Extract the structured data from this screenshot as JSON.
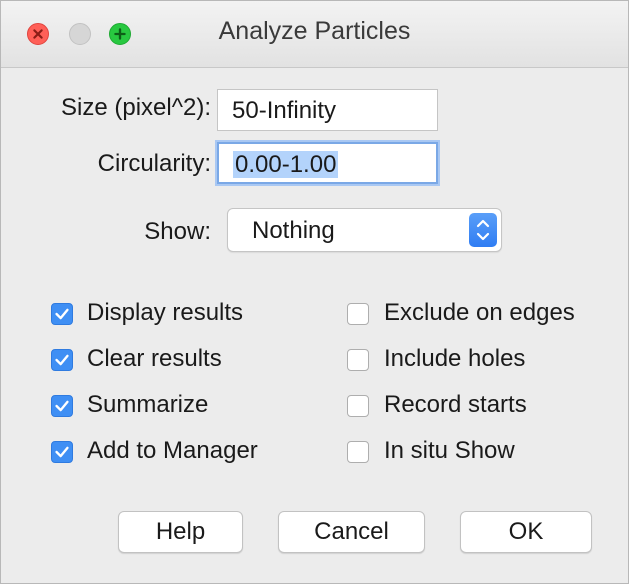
{
  "window": {
    "title": "Analyze Particles"
  },
  "fields": {
    "size": {
      "label": "Size (pixel^2):",
      "value": "50-Infinity"
    },
    "circularity": {
      "label": "Circularity:",
      "value": "0.00-1.00"
    }
  },
  "show": {
    "label": "Show:",
    "value": "Nothing"
  },
  "checkboxes": {
    "display_results": {
      "label": "Display results",
      "checked": true
    },
    "clear_results": {
      "label": "Clear results",
      "checked": true
    },
    "summarize": {
      "label": "Summarize",
      "checked": true
    },
    "add_to_manager": {
      "label": "Add to Manager",
      "checked": true
    },
    "exclude_on_edges": {
      "label": "Exclude on edges",
      "checked": false
    },
    "include_holes": {
      "label": "Include holes",
      "checked": false
    },
    "record_starts": {
      "label": "Record starts",
      "checked": false
    },
    "in_situ_show": {
      "label": "In situ Show",
      "checked": false
    }
  },
  "buttons": {
    "help": "Help",
    "cancel": "Cancel",
    "ok": "OK"
  },
  "colors": {
    "checkbox_accent": "#3f8ff4",
    "close": "#ff5f57",
    "zoom": "#28c840",
    "selection": "#b3d3fb"
  }
}
